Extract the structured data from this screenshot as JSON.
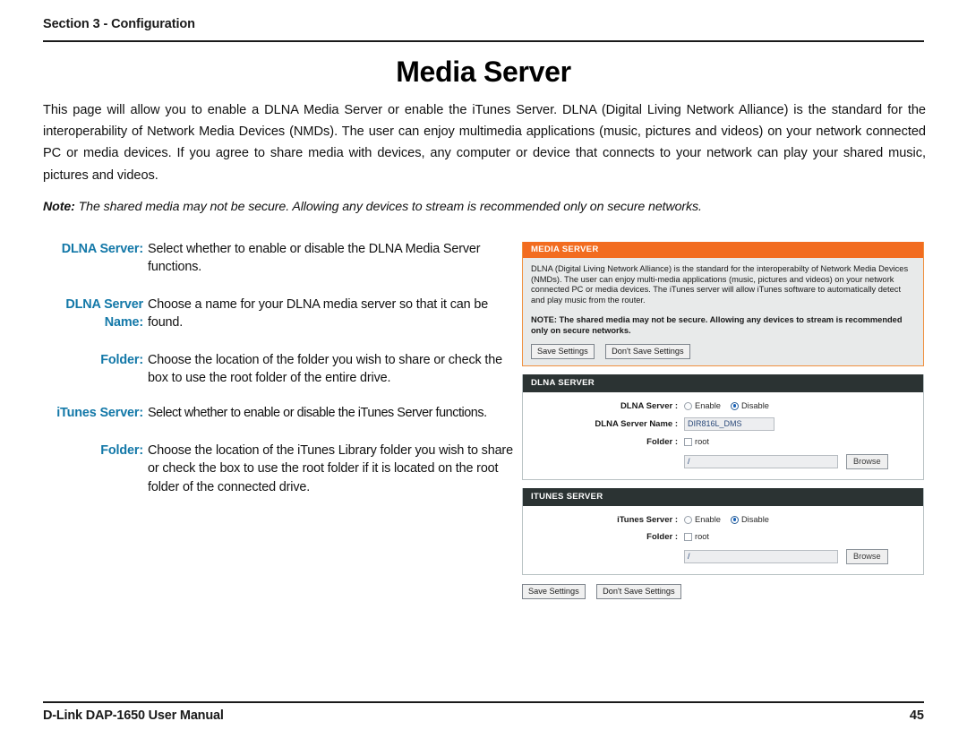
{
  "header": {
    "running_head": "Section 3 - Configuration",
    "title": "Media Server"
  },
  "intro": {
    "paragraph": "This page will allow you to enable a DLNA Media Server or enable the iTunes Server. DLNA (Digital Living Network Alliance) is the standard for the interoperability of Network Media Devices (NMDs). The user can enjoy multimedia applications (music, pictures and videos) on your network connected PC or media devices. If you agree to share media with devices, any computer or device that connects to your network can play your shared music, pictures and videos.",
    "note_label": "Note:",
    "note_text": "The shared media may not be secure. Allowing any devices to stream is recommended only on secure networks."
  },
  "definitions": [
    {
      "term": "DLNA Server:",
      "description": "Select whether to enable or disable the DLNA Media Server functions."
    },
    {
      "term": "DLNA Server Name:",
      "description": "Choose a name for your DLNA media server so that it can be found."
    },
    {
      "term": "Folder:",
      "description": "Choose the location of the folder you wish to share or check the box to use the root folder of the entire drive."
    },
    {
      "term": "iTunes Server:",
      "description": "Select whether to enable or disable the iTunes Server functions."
    },
    {
      "term": "Folder:",
      "description": "Choose the location of the iTunes Library folder you wish to share or check the box to use the root folder if it is located on the root folder of the connected drive."
    }
  ],
  "screenshot": {
    "media_panel": {
      "heading": "MEDIA SERVER",
      "body": "DLNA (Digital Living Network Alliance) is the standard for the interoperabilty of Network Media Devices (NMDs). The user can enjoy multi-media applications (music, pictures and videos) on your network connected PC or media devices. The iTunes server will allow iTunes software to automatically detect and play music from the router.",
      "note": "NOTE: The shared media may not be secure. Allowing any devices to stream is recommended only on secure networks.",
      "save_label": "Save Settings",
      "dont_save_label": "Don't Save Settings"
    },
    "dlna_panel": {
      "heading": "DLNA SERVER",
      "server_label": "DLNA Server :",
      "enable_label": "Enable",
      "disable_label": "Disable",
      "server_selected": "Disable",
      "name_label": "DLNA Server Name :",
      "name_value": "DIR816L_DMS",
      "folder_label": "Folder :",
      "root_label": "root",
      "root_checked": "false",
      "path_value": "/",
      "browse_label": "Browse"
    },
    "itunes_panel": {
      "heading": "ITUNES SERVER",
      "server_label": "iTunes Server :",
      "enable_label": "Enable",
      "disable_label": "Disable",
      "server_selected": "Disable",
      "folder_label": "Folder :",
      "root_label": "root",
      "root_checked": "false",
      "path_value": "/",
      "browse_label": "Browse"
    },
    "footer_buttons": {
      "save_label": "Save Settings",
      "dont_save_label": "Don't Save Settings"
    },
    "colors": {
      "accent_orange": "#f26c20",
      "panel_dark": "#2b3333",
      "label_blue": "#1378a8"
    }
  },
  "footer": {
    "manual_title": "D-Link DAP-1650 User Manual",
    "page_number": "45"
  }
}
